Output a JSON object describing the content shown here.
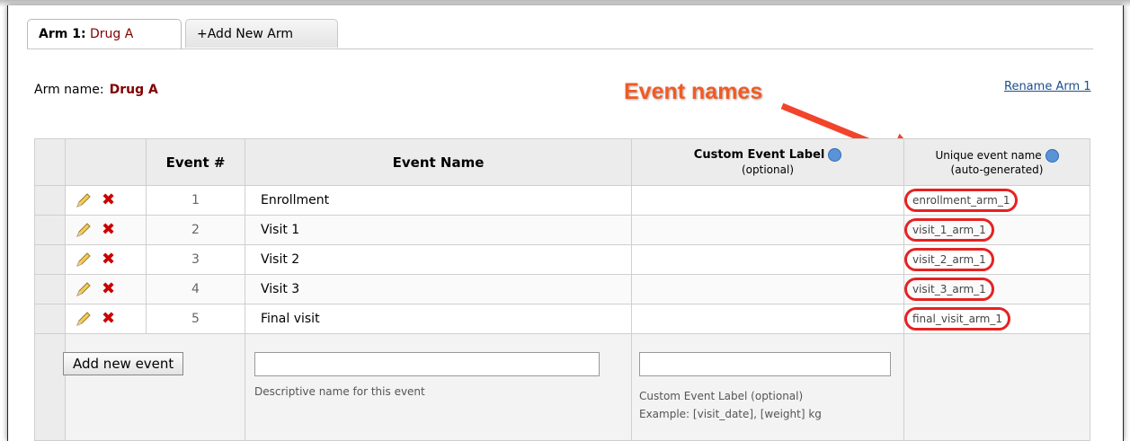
{
  "tabs": {
    "active_prefix": "Arm 1:",
    "active_name": "Drug A",
    "add_label": "+Add New Arm"
  },
  "arm": {
    "label": "Arm name:",
    "name": "Drug A",
    "rename_link": "Rename Arm 1"
  },
  "callout": {
    "text": "Event names",
    "color": "#f25a22"
  },
  "table": {
    "headers": {
      "event_num": "Event #",
      "event_name": "Event Name",
      "custom_label": "Custom Event Label",
      "custom_label_sub": "(optional)",
      "unique_name": "Unique event name",
      "unique_name_sub": "(auto-generated)"
    },
    "rows": [
      {
        "num": "1",
        "name": "Enrollment",
        "unique": "enrollment_arm_1"
      },
      {
        "num": "2",
        "name": "Visit 1",
        "unique": "visit_1_arm_1"
      },
      {
        "num": "3",
        "name": "Visit 2",
        "unique": "visit_2_arm_1"
      },
      {
        "num": "4",
        "name": "Visit 3",
        "unique": "visit_3_arm_1"
      },
      {
        "num": "5",
        "name": "Final visit",
        "unique": "final_visit_arm_1"
      }
    ],
    "footer": {
      "add_button": "Add new event",
      "name_hint": "Descriptive name for this event",
      "label_hint": "Custom Event Label (optional)",
      "label_example": "Example: [visit_date], [weight] kg"
    }
  },
  "colors": {
    "arm_name": "#800000",
    "highlight_circle": "#e52222",
    "delete_icon": "#cc0000"
  }
}
